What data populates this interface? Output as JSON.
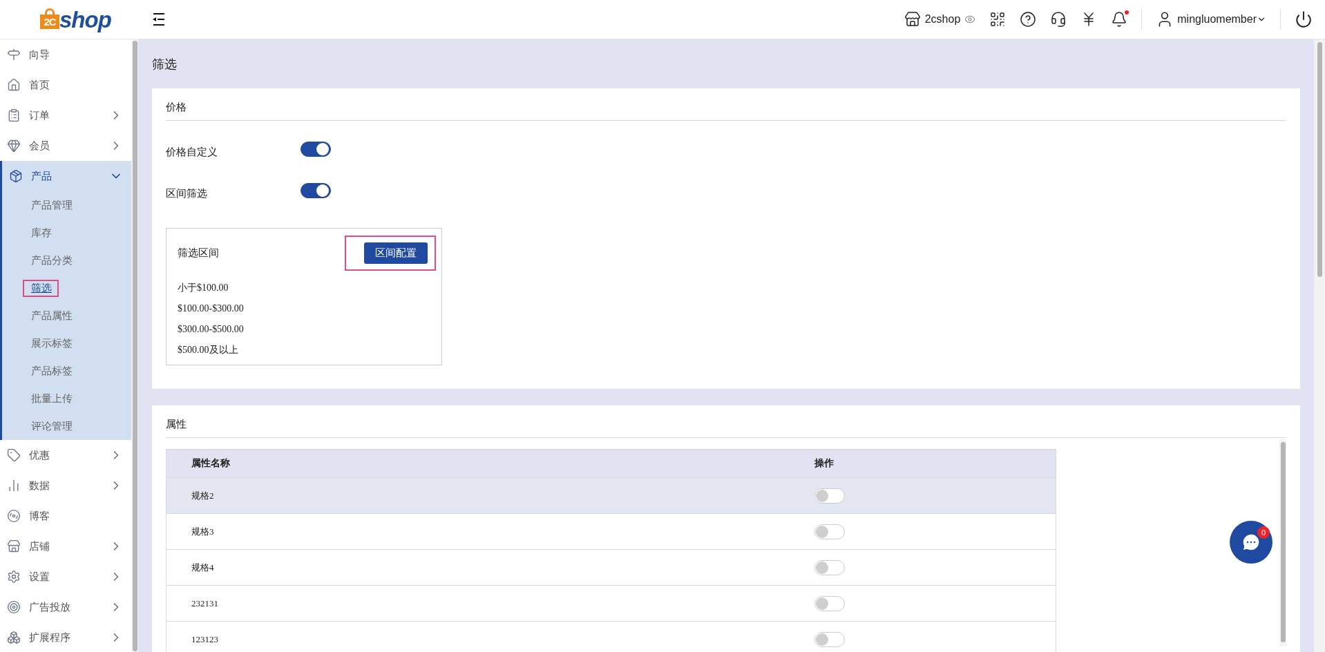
{
  "header": {
    "logo": {
      "mark": "2C",
      "text": "shop"
    },
    "store": "2cshop",
    "user": "mingluomember",
    "notification_dot": true
  },
  "sidebar": {
    "items": [
      {
        "label": "向导",
        "has_arrow": false,
        "expanded": false
      },
      {
        "label": "首页",
        "has_arrow": false,
        "expanded": false
      },
      {
        "label": "订单",
        "has_arrow": true,
        "expanded": false
      },
      {
        "label": "会员",
        "has_arrow": true,
        "expanded": false
      },
      {
        "label": "产品",
        "has_arrow": true,
        "expanded": true,
        "children": [
          {
            "label": "产品管理",
            "selected": false
          },
          {
            "label": "库存",
            "selected": false
          },
          {
            "label": "产品分类",
            "selected": false
          },
          {
            "label": "筛选",
            "selected": true
          },
          {
            "label": "产品属性",
            "selected": false
          },
          {
            "label": "展示标签",
            "selected": false
          },
          {
            "label": "产品标签",
            "selected": false
          },
          {
            "label": "批量上传",
            "selected": false
          },
          {
            "label": "评论管理",
            "selected": false
          }
        ]
      },
      {
        "label": "优惠",
        "has_arrow": true,
        "expanded": false
      },
      {
        "label": "数据",
        "has_arrow": true,
        "expanded": false
      },
      {
        "label": "博客",
        "has_arrow": false,
        "expanded": false
      },
      {
        "label": "店铺",
        "has_arrow": true,
        "expanded": false
      },
      {
        "label": "设置",
        "has_arrow": true,
        "expanded": false
      },
      {
        "label": "广告投放",
        "has_arrow": true,
        "expanded": false
      },
      {
        "label": "扩展程序",
        "has_arrow": true,
        "expanded": false
      }
    ]
  },
  "page_title": "筛选",
  "price": {
    "title": "价格",
    "toggles": [
      {
        "label": "价格自定义",
        "on": true
      },
      {
        "label": "区间筛选",
        "on": true
      }
    ],
    "ranges": {
      "title": "筛选区间",
      "button": "区间配置",
      "items": [
        "小于$100.00",
        "$100.00-$300.00",
        "$300.00-$500.00",
        "$500.00及以上"
      ]
    }
  },
  "attributes": {
    "title": "属性",
    "columns": [
      "属性名称",
      "操作"
    ],
    "rows": [
      {
        "name": "规格2",
        "on": false,
        "highlighted": true
      },
      {
        "name": "规格3",
        "on": false,
        "highlighted": false
      },
      {
        "name": "规格4",
        "on": false,
        "highlighted": false
      },
      {
        "name": "232131",
        "on": false,
        "highlighted": false
      },
      {
        "name": "123123",
        "on": false,
        "highlighted": false
      }
    ]
  },
  "chat": {
    "badge": "0"
  }
}
